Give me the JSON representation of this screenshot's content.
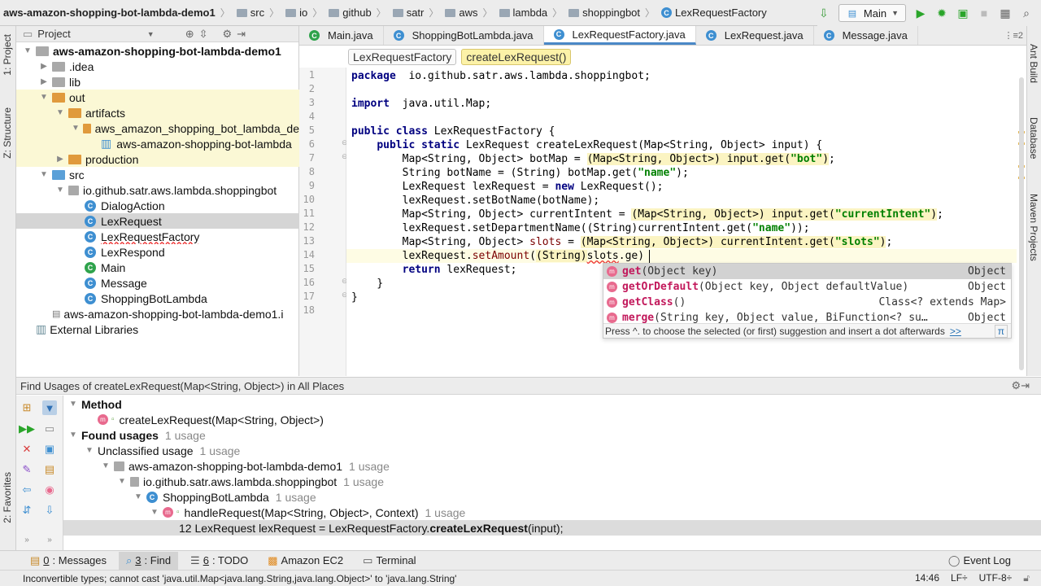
{
  "breadcrumb": [
    "aws-amazon-shopping-bot-lambda-demo1",
    "src",
    "io",
    "github",
    "satr",
    "aws",
    "lambda",
    "shoppingbot",
    "LexRequestFactory"
  ],
  "run_config": "Main",
  "side_tabs_left": [
    "1: Project",
    "Z: Structure",
    "2: Favorites"
  ],
  "side_tabs_right": [
    "Ant Build",
    "Database",
    "Maven Projects"
  ],
  "project_panel": {
    "title": "Project",
    "tree": [
      {
        "label": "aws-amazon-shopping-bot-lambda-demo1",
        "depth": 0,
        "arrow": "▼",
        "icon": "folder",
        "bold": true
      },
      {
        "label": ".idea",
        "depth": 1,
        "arrow": "▶",
        "icon": "folder"
      },
      {
        "label": "lib",
        "depth": 1,
        "arrow": "▶",
        "icon": "folder"
      },
      {
        "label": "out",
        "depth": 1,
        "arrow": "▼",
        "icon": "folder-orange",
        "hl": true
      },
      {
        "label": "artifacts",
        "depth": 2,
        "arrow": "▼",
        "icon": "folder-orange",
        "hl": true
      },
      {
        "label": "aws_amazon_shopping_bot_lambda_de",
        "depth": 3,
        "arrow": "▼",
        "icon": "folder-orange",
        "hl": true
      },
      {
        "label": "aws-amazon-shopping-bot-lambda",
        "depth": 4,
        "arrow": "",
        "icon": "jar",
        "hl": true
      },
      {
        "label": "production",
        "depth": 2,
        "arrow": "▶",
        "icon": "folder-orange",
        "hl": true
      },
      {
        "label": "src",
        "depth": 1,
        "arrow": "▼",
        "icon": "folder-blue"
      },
      {
        "label": "io.github.satr.aws.lambda.shoppingbot",
        "depth": 2,
        "arrow": "▼",
        "icon": "package"
      },
      {
        "label": "DialogAction",
        "depth": 3,
        "arrow": "",
        "icon": "class"
      },
      {
        "label": "LexRequest",
        "depth": 3,
        "arrow": "",
        "icon": "class",
        "selected": true
      },
      {
        "label": "LexRequestFactory",
        "depth": 3,
        "arrow": "",
        "icon": "class",
        "err": true
      },
      {
        "label": "LexRespond",
        "depth": 3,
        "arrow": "",
        "icon": "class"
      },
      {
        "label": "Main",
        "depth": 3,
        "arrow": "",
        "icon": "class-main"
      },
      {
        "label": "Message",
        "depth": 3,
        "arrow": "",
        "icon": "class"
      },
      {
        "label": "ShoppingBotLambda",
        "depth": 3,
        "arrow": "",
        "icon": "class"
      },
      {
        "label": "aws-amazon-shopping-bot-lambda-demo1.i",
        "depth": 1,
        "arrow": "",
        "icon": "iml"
      },
      {
        "label": "External Libraries",
        "depth": 0,
        "arrow": "",
        "icon": "libs"
      }
    ]
  },
  "editor_tabs": [
    {
      "label": "Main.java",
      "active": false
    },
    {
      "label": "ShoppingBotLambda.java",
      "active": false
    },
    {
      "label": "LexRequestFactory.java",
      "active": true
    },
    {
      "label": "LexRequest.java",
      "active": false
    },
    {
      "label": "Message.java",
      "active": false
    }
  ],
  "tab_overflow": "⋮≡2",
  "editor_breadcrumb": [
    "LexRequestFactory",
    "createLexRequest()"
  ],
  "line_numbers": [
    "1",
    "2",
    "3",
    "4",
    "5",
    "6",
    "7",
    "8",
    "9",
    "10",
    "11",
    "12",
    "13",
    "14",
    "15",
    "16",
    "17",
    "18"
  ],
  "code_lines": [
    [
      [
        "kw",
        "package"
      ],
      [
        "",
        "  io.github.satr.aws.lambda.shoppingbot;"
      ]
    ],
    [],
    [
      [
        "kw",
        "import"
      ],
      [
        "",
        "  java.util.Map;"
      ]
    ],
    [],
    [
      [
        "kw",
        "public class"
      ],
      [
        "",
        " LexRequestFactory {"
      ]
    ],
    [
      [
        "",
        "    "
      ],
      [
        "kw",
        "public static"
      ],
      [
        "",
        " LexRequest createLexRequest(Map<String, Object> input) {"
      ]
    ],
    [
      [
        "",
        "        Map<String, Object> botMap = "
      ],
      [
        "mark",
        "(Map<String, Object>) input.get("
      ],
      [
        "mark st",
        "\"bot\""
      ],
      [
        "mark",
        ")"
      ],
      [
        "",
        ";"
      ]
    ],
    [
      [
        "",
        "        String botName = (String) botMap.get("
      ],
      [
        "st",
        "\"name\""
      ],
      [
        "",
        ");"
      ]
    ],
    [
      [
        "",
        "        LexRequest lexRequest = "
      ],
      [
        "kw",
        "new"
      ],
      [
        "",
        " LexRequest();"
      ]
    ],
    [
      [
        "",
        "        lexRequest.setBotName(botName);"
      ]
    ],
    [
      [
        "",
        "        Map<String, Object> currentIntent = "
      ],
      [
        "mark",
        "(Map<String, Object>) input.get("
      ],
      [
        "mark st",
        "\"currentIntent\""
      ],
      [
        "mark",
        ")"
      ],
      [
        "",
        ";"
      ]
    ],
    [
      [
        "",
        "        lexRequest.setDepartmentName((String)currentIntent.get("
      ],
      [
        "st",
        "\"name\""
      ],
      [
        "",
        "));"
      ]
    ],
    [
      [
        "",
        "        Map<String, Object> "
      ],
      [
        "fn",
        "slots"
      ],
      [
        "",
        " = "
      ],
      [
        "mark",
        "(Map<String, Object>) currentIntent.get("
      ],
      [
        "mark st",
        "\"slots\""
      ],
      [
        "mark",
        ")"
      ],
      [
        "",
        ";"
      ]
    ],
    [
      [
        "",
        "        lexRequest."
      ],
      [
        "fn",
        "setAmount"
      ],
      [
        "",
        "("
      ],
      [
        "mark",
        "(String)"
      ],
      [
        "err",
        "slots"
      ],
      [
        "",
        ".ge)"
      ]
    ],
    [
      [
        "",
        "        "
      ],
      [
        "kw",
        "return"
      ],
      [
        "",
        " lexRequest;"
      ]
    ],
    [
      [
        "",
        "    }"
      ]
    ],
    [
      [
        "",
        "}"
      ]
    ],
    []
  ],
  "completion": {
    "items": [
      {
        "icon": "m",
        "name": "get",
        "args": "(Object key)",
        "ret": "Object",
        "selected": true
      },
      {
        "icon": "m",
        "name": "getOrDefault",
        "args": "(Object key, Object defaultValue)",
        "ret": "Object"
      },
      {
        "icon": "m",
        "name": "getClass",
        "args": "()",
        "ret": "Class<? extends Map>"
      },
      {
        "icon": "m",
        "name": "merge",
        "args": "(String key, Object value, BiFunction<? su…",
        "ret": "Object"
      }
    ],
    "hint": "Press ^. to choose the selected (or first) suggestion and insert a dot afterwards",
    "hint_link": ">>",
    "pi": "π"
  },
  "find_panel": {
    "title": "Find Usages of createLexRequest(Map<String, Object>) in All Places",
    "rows": [
      {
        "depth": 0,
        "arrow": "▼",
        "text": "Method",
        "bold": true,
        "count": ""
      },
      {
        "depth": 1,
        "arrow": "",
        "icon": "method",
        "text": "createLexRequest(Map<String, Object>)",
        "count": ""
      },
      {
        "depth": 0,
        "arrow": "▼",
        "text": "Found usages",
        "bold": true,
        "count": "1 usage"
      },
      {
        "depth": 1,
        "arrow": "▼",
        "text": "Unclassified usage",
        "count": "1 usage"
      },
      {
        "depth": 2,
        "arrow": "▼",
        "icon": "folder",
        "text": "aws-amazon-shopping-bot-lambda-demo1",
        "count": "1 usage"
      },
      {
        "depth": 3,
        "arrow": "▼",
        "icon": "package",
        "text": "io.github.satr.aws.lambda.shoppingbot",
        "count": "1 usage"
      },
      {
        "depth": 4,
        "arrow": "▼",
        "icon": "class",
        "text": "ShoppingBotLambda",
        "count": "1 usage"
      },
      {
        "depth": 5,
        "arrow": "▼",
        "icon": "method",
        "text": "handleRequest(Map<String, Object>, Context)",
        "count": "1 usage"
      },
      {
        "depth": 6,
        "arrow": "",
        "text": "12 LexRequest lexRequest = LexRequestFactory.",
        "bold_tail": "createLexRequest",
        "tail": "(input);",
        "count": "",
        "selected": true
      }
    ]
  },
  "bottom_tabs": [
    {
      "num": "0",
      "label": ": Messages",
      "active": false
    },
    {
      "num": "3",
      "label": ": Find",
      "active": true
    },
    {
      "num": "6",
      "label": ": TODO",
      "active": false
    },
    {
      "num": "",
      "label": "Amazon EC2",
      "active": false
    },
    {
      "num": "",
      "label": "Terminal",
      "active": false
    }
  ],
  "event_log": "Event Log",
  "status": {
    "message": "Inconvertible types; cannot cast 'java.util.Map<java.lang.String,java.lang.Object>' to 'java.lang.String'",
    "position": "14:46",
    "line_sep": "LF÷",
    "encoding": "UTF-8÷"
  }
}
